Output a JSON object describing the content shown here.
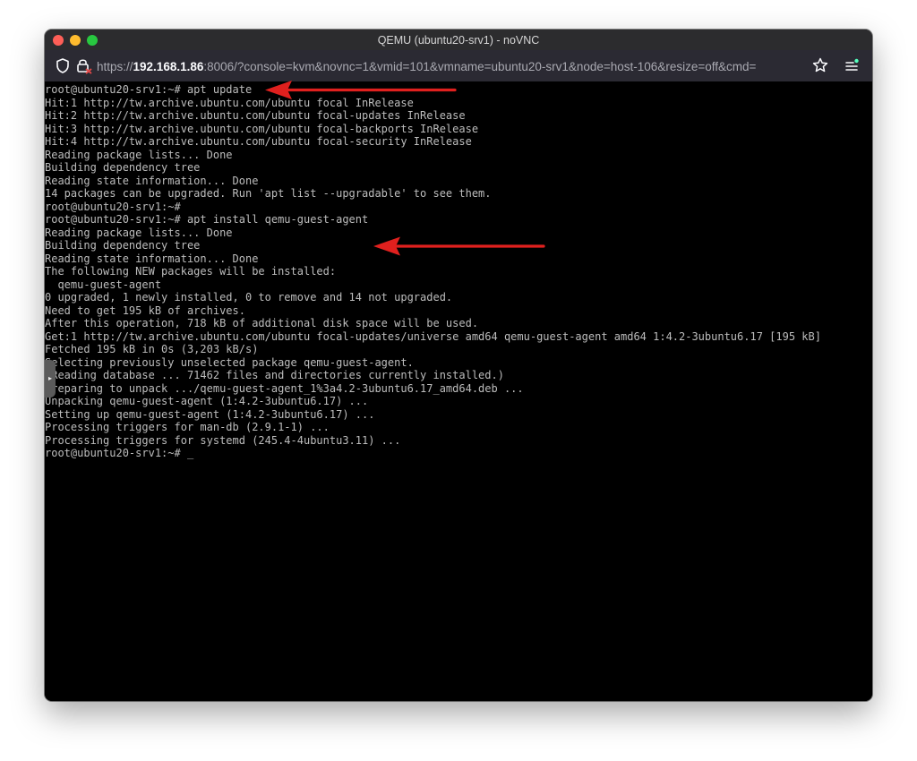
{
  "window": {
    "title": "QEMU (ubuntu20-srv1) - noVNC"
  },
  "toolbar": {
    "url_scheme": "https://",
    "url_host": "192.168.1.86",
    "url_rest": ":8006/?console=kvm&novnc=1&vmid=101&vmname=ubuntu20-srv1&node=host-106&resize=off&cmd=",
    "icons": [
      "shield-icon",
      "lock-icon",
      "star-icon",
      "menu-icon"
    ]
  },
  "console": {
    "lines": [
      "root@ubuntu20-srv1:~# apt update",
      "Hit:1 http://tw.archive.ubuntu.com/ubuntu focal InRelease",
      "Hit:2 http://tw.archive.ubuntu.com/ubuntu focal-updates InRelease",
      "Hit:3 http://tw.archive.ubuntu.com/ubuntu focal-backports InRelease",
      "Hit:4 http://tw.archive.ubuntu.com/ubuntu focal-security InRelease",
      "Reading package lists... Done",
      "Building dependency tree",
      "Reading state information... Done",
      "14 packages can be upgraded. Run 'apt list --upgradable' to see them.",
      "root@ubuntu20-srv1:~#",
      "root@ubuntu20-srv1:~# apt install qemu-guest-agent",
      "Reading package lists... Done",
      "Building dependency tree",
      "Reading state information... Done",
      "The following NEW packages will be installed:",
      "  qemu-guest-agent",
      "0 upgraded, 1 newly installed, 0 to remove and 14 not upgraded.",
      "Need to get 195 kB of archives.",
      "After this operation, 718 kB of additional disk space will be used.",
      "Get:1 http://tw.archive.ubuntu.com/ubuntu focal-updates/universe amd64 qemu-guest-agent amd64 1:4.2-3ubuntu6.17 [195 kB]",
      "Fetched 195 kB in 0s (3,203 kB/s)",
      "Selecting previously unselected package qemu-guest-agent.",
      "(Reading database ... 71462 files and directories currently installed.)",
      "Preparing to unpack .../qemu-guest-agent_1%3a4.2-3ubuntu6.17_amd64.deb ...",
      "Unpacking qemu-guest-agent (1:4.2-3ubuntu6.17) ...",
      "Setting up qemu-guest-agent (1:4.2-3ubuntu6.17) ...",
      "Processing triggers for man-db (2.9.1-1) ...",
      "Processing triggers for systemd (245.4-4ubuntu3.11) ...",
      "root@ubuntu20-srv1:~# "
    ],
    "cursor": "_"
  },
  "control_bar": {
    "handle_glyph": "▸"
  },
  "colors": {
    "annotation_arrow": "#e0201e",
    "terminal_text": "#bdbdbd",
    "terminal_background": "#000000"
  }
}
